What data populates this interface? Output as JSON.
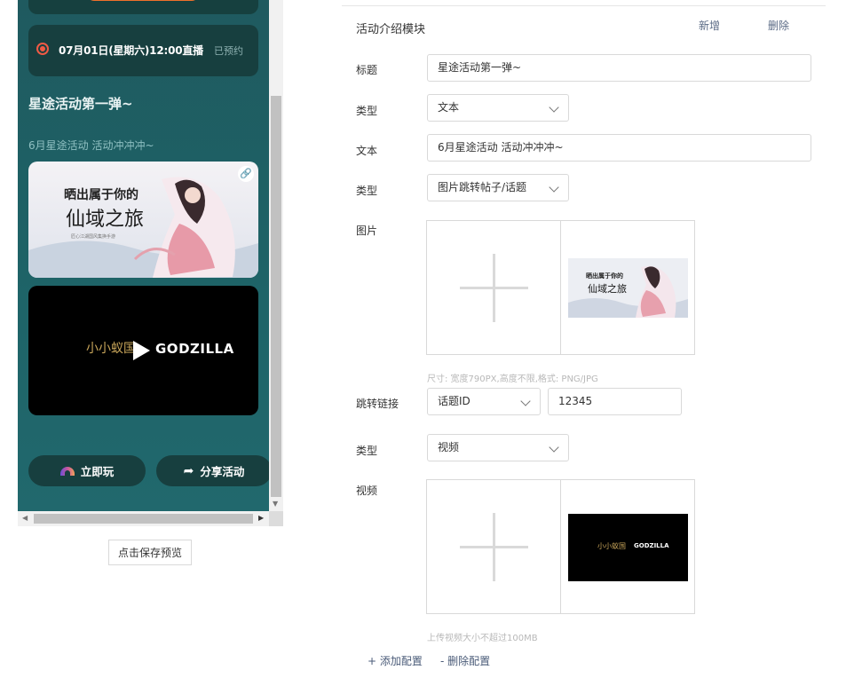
{
  "preview": {
    "live": {
      "time_text": "07月01日(星期六)12:00直播",
      "status": "已预约"
    },
    "activity_title": "星途活动第一弹~",
    "activity_subtitle": "6月星途活动 活动冲冲冲~",
    "poster": {
      "line1": "晒出属于你的",
      "line2": "仙域之旅",
      "tag": "匠心江湖国风集换手游"
    },
    "video": {
      "brand_cn": "小小蚁国",
      "brand_en": "GODZILLA"
    },
    "buttons": {
      "play": "立即玩",
      "share": "分享活动"
    },
    "save_preview": "点击保存预览"
  },
  "form": {
    "module_title": "活动介绍模块",
    "add": "新增",
    "delete": "删除",
    "fields": {
      "title_label": "标题",
      "title_value": "星途活动第一弹~",
      "type1_label": "类型",
      "type1_value": "文本",
      "text_label": "文本",
      "text_value": "6月星途活动 活动冲冲冲~",
      "type2_label": "类型",
      "type2_value": "图片跳转帖子/话题",
      "image_label": "图片",
      "image_hint": "尺寸: 宽度790PX,高度不限,格式: PNG/JPG",
      "jump_label": "跳转链接",
      "jump_type": "话题ID",
      "jump_value": "12345",
      "type3_label": "类型",
      "type3_value": "视频",
      "video_label": "视频",
      "video_hint": "上传视频大小不超过100MB",
      "video_thumb_cn": "小小蚁国",
      "video_thumb_en": "GODZILLA"
    },
    "add_config": "+ 添加配置",
    "remove_config": "- 删除配置"
  },
  "colors": {
    "preview_bg": "#1f5f63",
    "card_bg": "#173f3f",
    "live_red": "#f05a45",
    "accent_orange": "#f0712b"
  }
}
